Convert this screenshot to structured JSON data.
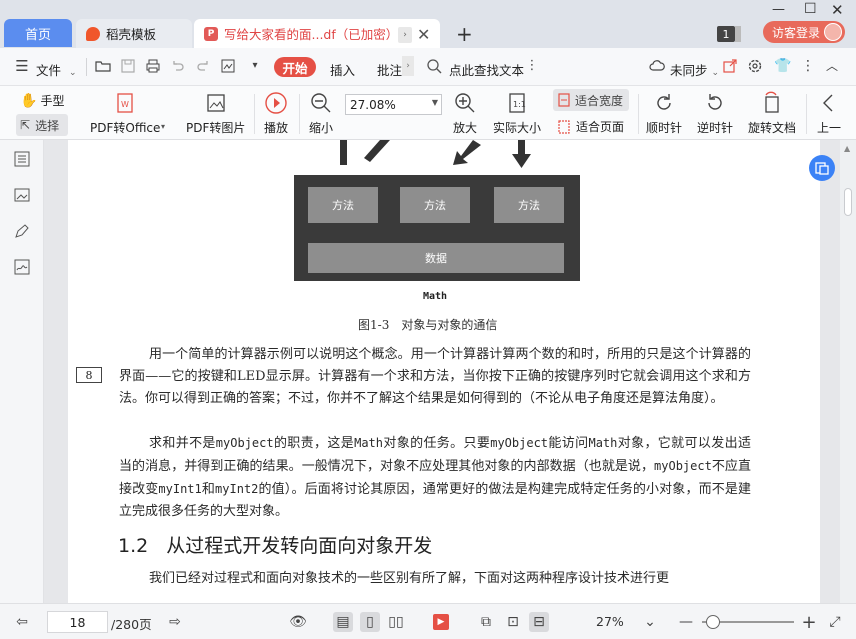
{
  "tabs": {
    "home_label": "首页",
    "daoke_label": "稻壳模板",
    "pdf_label": "写给大家看的面...df（已加密）"
  },
  "window": {
    "page_count_badge": "1",
    "login_label": "访客登录"
  },
  "menu": {
    "file_label": "文件",
    "start_label": "开始",
    "insert_label": "插入",
    "annotate_label": "批注",
    "search_label": "点此查找文本",
    "sync_label": "未同步"
  },
  "toolbar": {
    "hand_label": "手型",
    "select_label": "选择",
    "pdf_to_office": "PDF转Office",
    "pdf_to_image": "PDF转图片",
    "play_label": "播放",
    "zoom_out_label": "缩小",
    "zoom_value": "27.08%",
    "zoom_in_label": "放大",
    "actual_size_label": "实际大小",
    "fit_width_label": "适合宽度",
    "fit_page_label": "适合页面",
    "rotate_cw_label": "顺时针",
    "rotate_ccw_label": "逆时针",
    "rotate_doc_label": "旋转文档",
    "prev_label": "上一"
  },
  "document": {
    "diagram": {
      "methods": [
        "方法",
        "方法",
        "方法"
      ],
      "data_label": "数据",
      "object_name": "Math"
    },
    "figure_caption": "图1-3　对象与对象的通信",
    "page_number": "8",
    "paragraph1": "用一个简单的计算器示例可以说明这个概念。用一个计算器计算两个数的和时，所用的只是这个计算器的界面——它的按键和LED显示屏。计算器有一个求和方法，当你按下正确的按键序列时它就会调用这个求和方法。你可以得到正确的答案；不过，你并不了解这个结果是如何得到的（不论从电子角度还是算法角度）。",
    "p2_a": "求和并不是",
    "p2_code1": "myObject",
    "p2_b": "的职责，这是",
    "p2_code2": "Math",
    "p2_c": "对象的任务。只要",
    "p2_code3": "myObject",
    "p2_d": "能访问",
    "p2_code4": "Math",
    "p2_e": "对象，它就可以发出适当的消息，并得到正确的结果。一般情况下，对象不应处理其他对象的内部数据（也就是说，",
    "p2_code5": "myObject",
    "p2_f": "不应直接改变",
    "p2_code6": "myInt1",
    "p2_g": "和",
    "p2_code7": "myInt2",
    "p2_h": "的值）。后面将讨论其原因，通常更好的做法是构建完成特定任务的小对象，而不是建立完成很多任务的大型对象。",
    "section_number": "1.2",
    "section_title": "从过程式开发转向面向对象开发",
    "paragraph3": "我们已经对过程式和面向对象技术的一些区别有所了解，下面对这两种程序设计技术进行更"
  },
  "status": {
    "current_page": "18",
    "total_pages": "/280页",
    "zoom_pct": "27%"
  },
  "colors": {
    "accent_blue": "#5b8def",
    "brand_red": "#e55045",
    "float_blue": "#3b82f6"
  }
}
